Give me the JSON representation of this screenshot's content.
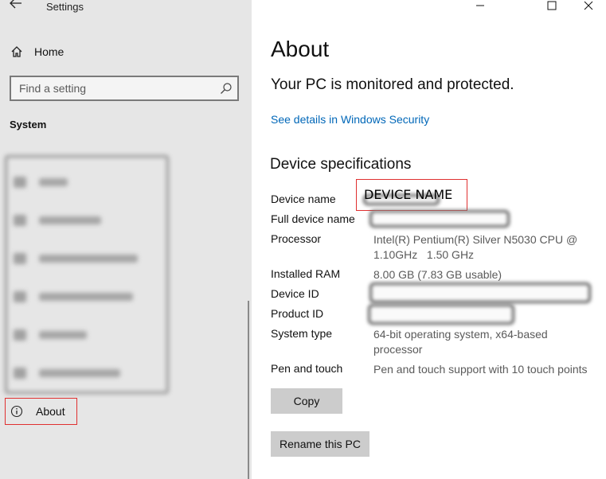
{
  "window": {
    "title": "Settings"
  },
  "sidebar": {
    "home_label": "Home",
    "search_placeholder": "Find a setting",
    "section_header": "System",
    "about_label": "About"
  },
  "main": {
    "page_title": "About",
    "protection_status": "Your PC is monitored and protected.",
    "security_link": "See details in Windows Security",
    "specs_header": "Device specifications",
    "specs": {
      "device_name_label": "Device name",
      "device_name_value": "DEVICE NAME",
      "full_device_name_label": "Full device name",
      "processor_label": "Processor",
      "processor_value_line1": "Intel(R) Pentium(R) Silver N5030 CPU @",
      "processor_value_line2": "1.10GHz   1.50 GHz",
      "installed_ram_label": "Installed RAM",
      "installed_ram_value": "8.00 GB (7.83 GB usable)",
      "device_id_label": "Device ID",
      "product_id_label": "Product ID",
      "system_type_label": "System type",
      "system_type_value_line1": "64-bit operating system, x64-based",
      "system_type_value_line2": "processor",
      "pen_touch_label": "Pen and touch",
      "pen_touch_value": "Pen and touch support with 10 touch points"
    },
    "copy_button": "Copy",
    "rename_button": "Rename this PC"
  },
  "colors": {
    "link": "#0067b8",
    "highlight_border": "#e03030",
    "button_bg": "#cccccc"
  }
}
